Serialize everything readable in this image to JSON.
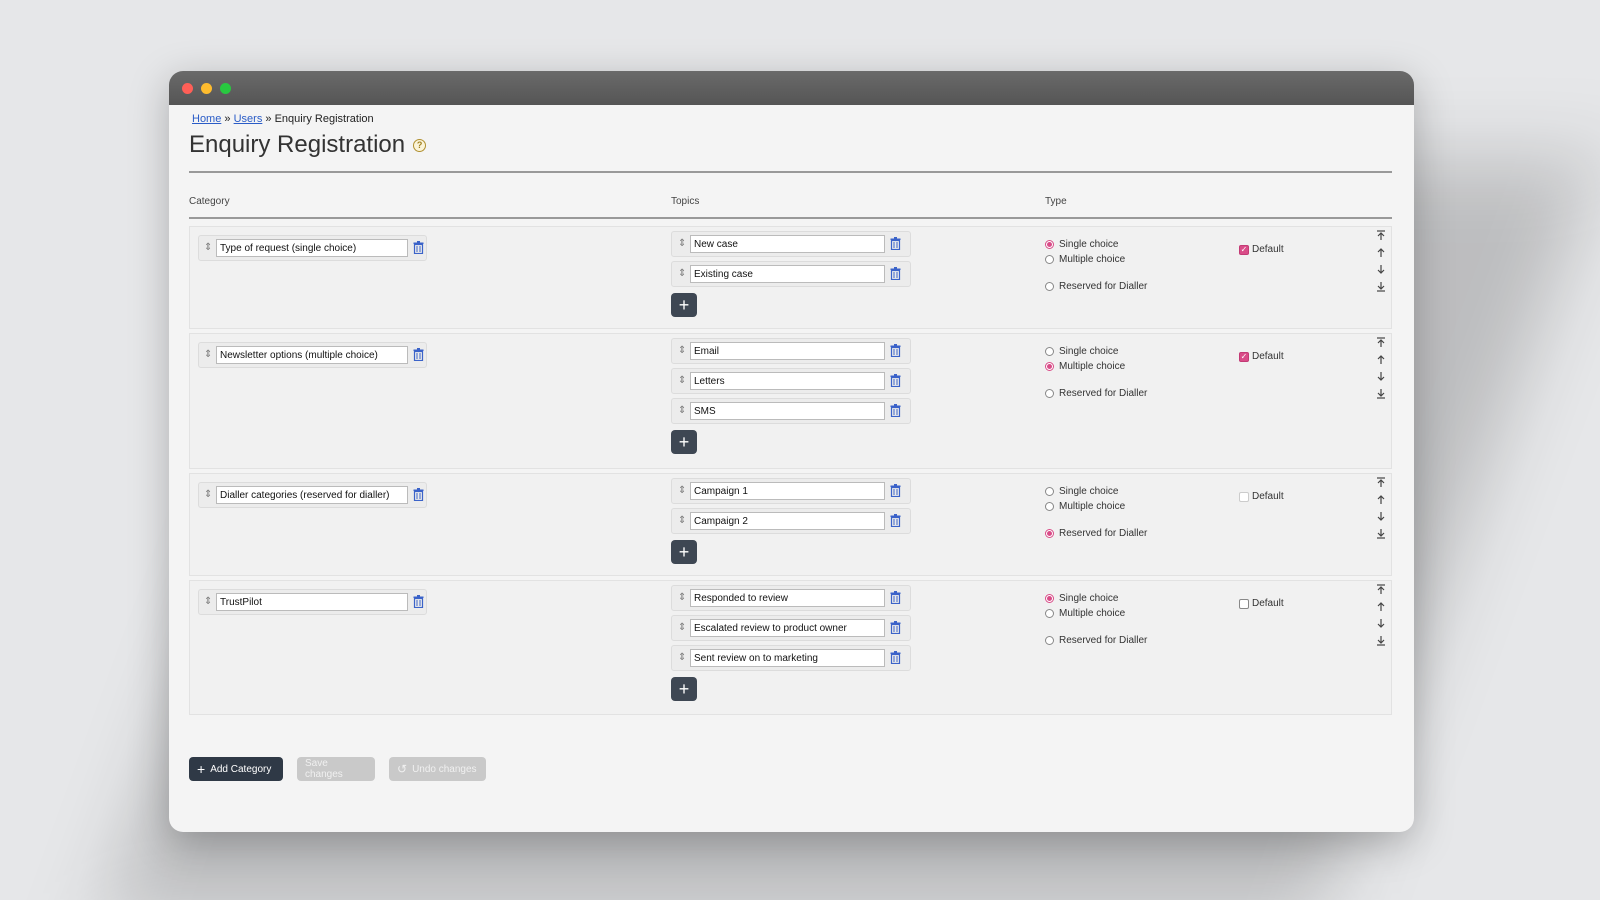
{
  "breadcrumb": {
    "home": "Home",
    "sep1": "»",
    "users": "Users",
    "sep2": "»",
    "current": "Enquiry Registration"
  },
  "page": {
    "title": "Enquiry Registration",
    "help": "?"
  },
  "columns": {
    "category": "Category",
    "topics": "Topics",
    "type": "Type"
  },
  "type_labels": {
    "single": "Single choice",
    "multiple": "Multiple choice",
    "dialler": "Reserved for Dialler",
    "default": "Default"
  },
  "categories": [
    {
      "name": "Type of request (single choice)",
      "topics": [
        "New case",
        "Existing case"
      ],
      "type": "single",
      "default": true
    },
    {
      "name": "Newsletter options (multiple choice)",
      "topics": [
        "Email",
        "Letters",
        "SMS"
      ],
      "type": "multiple",
      "default": true
    },
    {
      "name": "Dialler categories (reserved for dialler)",
      "topics": [
        "Campaign 1",
        "Campaign 2"
      ],
      "type": "dialler",
      "default": false
    },
    {
      "name": "TrustPilot",
      "topics": [
        "Responded to review",
        "Escalated review to product owner",
        "Sent review on to marketing"
      ],
      "type": "single",
      "default": false
    }
  ],
  "footer": {
    "add_category": "Add Category",
    "save": "Save changes",
    "undo": "Undo changes"
  },
  "colors": {
    "accent": "#d94c88",
    "dark_button": "#2f3946",
    "trash": "#3b63c9"
  }
}
